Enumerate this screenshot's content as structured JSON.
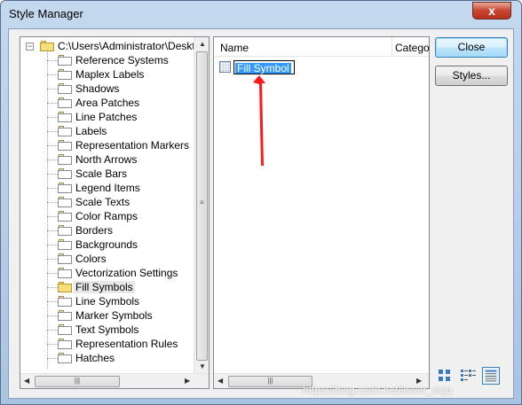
{
  "window": {
    "title": "Style Manager",
    "close_glyph": "x"
  },
  "tree": {
    "root_label": "C:\\Users\\Administrator\\Desktop",
    "expander_glyph": "−",
    "selected_item": "Fill Symbols",
    "items": [
      "Reference Systems",
      "Maplex Labels",
      "Shadows",
      "Area Patches",
      "Line Patches",
      "Labels",
      "Representation Markers",
      "North Arrows",
      "Scale Bars",
      "Legend Items",
      "Scale Texts",
      "Color Ramps",
      "Borders",
      "Backgrounds",
      "Colors",
      "Vectorization Settings",
      "Fill Symbols",
      "Line Symbols",
      "Marker Symbols",
      "Text Symbols",
      "Representation Rules",
      "Hatches"
    ]
  },
  "list": {
    "columns": [
      "Name",
      "Category"
    ],
    "items": [
      {
        "name": "Fill Symbol",
        "editing": true
      }
    ]
  },
  "buttons": {
    "close": "Close",
    "styles": "Styles..."
  },
  "view_modes": [
    "large-icons-view-icon",
    "list-view-icon",
    "details-view-icon"
  ],
  "active_view": "details-view-icon",
  "annotation_color": "#ff1a1a",
  "watermark": "https://blog.csdn.net/lower_wgq"
}
